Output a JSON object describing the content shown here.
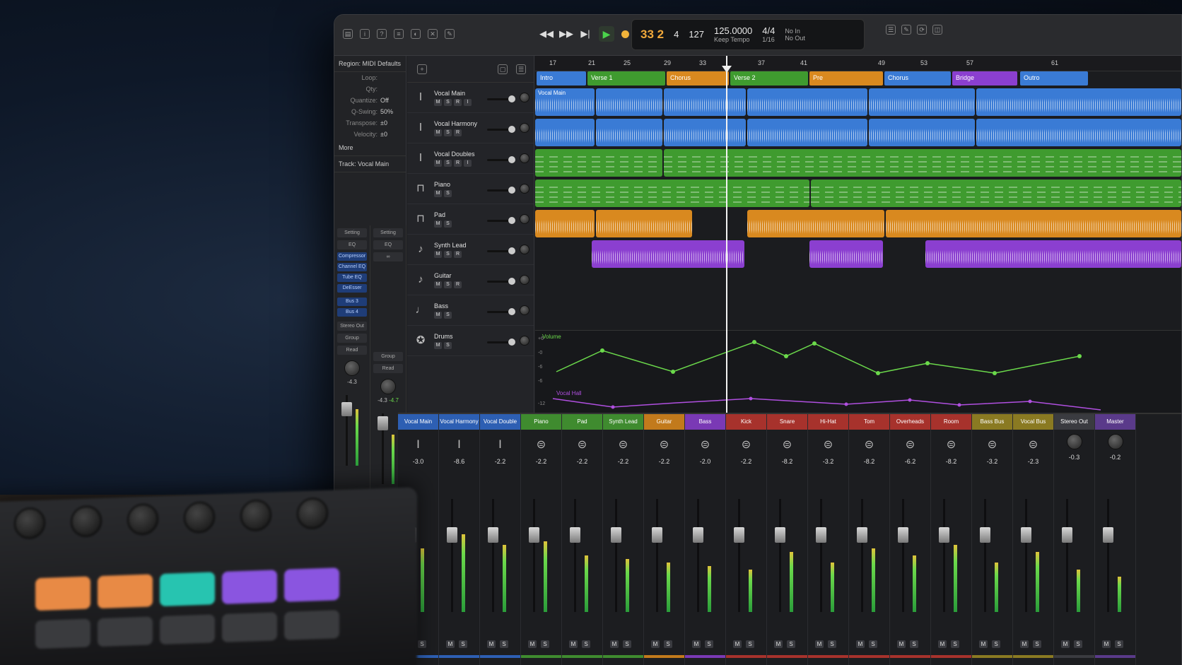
{
  "toolbar": {
    "transport_icons": [
      "rewind",
      "fast-forward",
      "skip-to-start",
      "play",
      "cycle",
      "record"
    ],
    "lcd": {
      "bar": "33 2",
      "beat": "4",
      "tick": "127",
      "tempo": "125.0000",
      "tempo_mode": "Keep Tempo",
      "signature": "4/4",
      "division": "1/16",
      "midi_in": "No In",
      "midi_out": "No Out"
    }
  },
  "inspector": {
    "region_header": "Region: MIDI Defaults",
    "rows": [
      {
        "label": "Loop:",
        "value": ""
      },
      {
        "label": "Qty:",
        "value": ""
      },
      {
        "label": "Quantize:",
        "value": "Off"
      },
      {
        "label": "Q-Swing:",
        "value": "50%"
      },
      {
        "label": "Transpose:",
        "value": "±0"
      },
      {
        "label": "Velocity:",
        "value": "±0"
      }
    ],
    "more_label": "More",
    "track_header": "Track: Vocal Main",
    "strip_left": {
      "setting": "Setting",
      "eq": "EQ",
      "plugins": [
        "Compressor",
        "Channel EQ",
        "Tube EQ",
        "DeEsser"
      ],
      "sends": [
        "Bus 3",
        "Bus 4"
      ],
      "output": "Stereo Out",
      "group": "Group",
      "automation": "Read",
      "value_a": "-4.3",
      "value_b": ""
    },
    "strip_right": {
      "setting": "Setting",
      "eq": "EQ",
      "group": "Group",
      "automation": "Read",
      "value_a": "-4.3",
      "value_b": "-4.7"
    }
  },
  "tracks": [
    {
      "name": "Vocal Main",
      "icon": "mic-icon",
      "buttons": [
        "M",
        "S",
        "R",
        "I"
      ]
    },
    {
      "name": "Vocal Harmony",
      "icon": "mic-icon",
      "buttons": [
        "M",
        "S",
        "R"
      ]
    },
    {
      "name": "Vocal Doubles",
      "icon": "mic-icon",
      "buttons": [
        "M",
        "S",
        "R",
        "I"
      ]
    },
    {
      "name": "Piano",
      "icon": "piano-icon",
      "buttons": [
        "M",
        "S"
      ]
    },
    {
      "name": "Pad",
      "icon": "keyboard-icon",
      "buttons": [
        "M",
        "S"
      ]
    },
    {
      "name": "Synth Lead",
      "icon": "guitar-icon",
      "buttons": [
        "M",
        "S",
        "R"
      ]
    },
    {
      "name": "Guitar",
      "icon": "guitar-icon",
      "buttons": [
        "M",
        "S",
        "R"
      ]
    },
    {
      "name": "Bass",
      "icon": "bass-icon",
      "buttons": [
        "M",
        "S"
      ]
    },
    {
      "name": "Drums",
      "icon": "drums-icon",
      "buttons": [
        "M",
        "S"
      ]
    }
  ],
  "ruler": {
    "bars": [
      "17",
      "21",
      "25",
      "29",
      "33",
      "37",
      "41",
      "49",
      "53",
      "57",
      "61"
    ]
  },
  "markers": [
    {
      "label": "Intro",
      "color": "#3a7bd5"
    },
    {
      "label": "Verse 1",
      "color": "#3f9b2f"
    },
    {
      "label": "Chorus",
      "color": "#d9891f"
    },
    {
      "label": "Verse 2",
      "color": "#3f9b2f"
    },
    {
      "label": "Pre",
      "color": "#d9891f"
    },
    {
      "label": "Chorus",
      "color": "#3a7bd5"
    },
    {
      "label": "Bridge",
      "color": "#8b3fd0"
    },
    {
      "label": "Outro",
      "color": "#3a7bd5"
    }
  ],
  "regions": {
    "vocal_main_label": "Vocal Main"
  },
  "automation": {
    "lane1_label": "Volume",
    "lane1_color": "#6bd94b",
    "lane2_label": "Vocal Hall",
    "lane2_color": "#b04fe0",
    "scale": [
      "+6",
      "-0",
      "-6",
      "-6",
      "-12"
    ]
  },
  "mixer": {
    "channels": [
      {
        "name": "Vocal Main",
        "color": "#2d5fb3",
        "value": "-3.0",
        "icon": "mic-icon"
      },
      {
        "name": "Vocal Harmony",
        "color": "#2d5fb3",
        "value": "-8.6",
        "icon": "mic-icon"
      },
      {
        "name": "Vocal Double",
        "color": "#2d5fb3",
        "value": "-2.2",
        "icon": "mic-icon"
      },
      {
        "name": "Piano",
        "color": "#3f8b2f",
        "value": "-2.2",
        "icon": "channel-icon"
      },
      {
        "name": "Pad",
        "color": "#3f8b2f",
        "value": "-2.2",
        "icon": "channel-icon"
      },
      {
        "name": "Synth Lead",
        "color": "#3f8b2f",
        "value": "-2.2",
        "icon": "channel-icon"
      },
      {
        "name": "Guitar",
        "color": "#c27a1c",
        "value": "-2.2",
        "icon": "channel-icon"
      },
      {
        "name": "Bass",
        "color": "#7a39b5",
        "value": "-2.0",
        "icon": "channel-icon"
      },
      {
        "name": "Kick",
        "color": "#a7322c",
        "value": "-2.2",
        "icon": "channel-icon"
      },
      {
        "name": "Snare",
        "color": "#a7322c",
        "value": "-8.2",
        "icon": "channel-icon"
      },
      {
        "name": "Hi-Hat",
        "color": "#a7322c",
        "value": "-3.2",
        "icon": "channel-icon"
      },
      {
        "name": "Tom",
        "color": "#a7322c",
        "value": "-8.2",
        "icon": "channel-icon"
      },
      {
        "name": "Overheads",
        "color": "#a7322c",
        "value": "-6.2",
        "icon": "channel-icon"
      },
      {
        "name": "Room",
        "color": "#a7322c",
        "value": "-8.2",
        "icon": "channel-icon"
      },
      {
        "name": "Bass Bus",
        "color": "#8a7a22",
        "value": "-3.2",
        "icon": "channel-icon"
      },
      {
        "name": "Vocal Bus",
        "color": "#8a7a22",
        "value": "-2.3",
        "icon": "channel-icon"
      },
      {
        "name": "Stereo Out",
        "color": "#3a3b40",
        "value": "-0.3",
        "icon": "knob-icon"
      },
      {
        "name": "Master",
        "color": "#5a3a8a",
        "value": "-0.2",
        "icon": "knob-icon"
      }
    ],
    "m_label": "M",
    "s_label": "S"
  },
  "controller": {
    "pad_colors": [
      "#e88a45",
      "#e88a45",
      "#27c4b0",
      "#8a55e0",
      "#8a55e0"
    ]
  }
}
